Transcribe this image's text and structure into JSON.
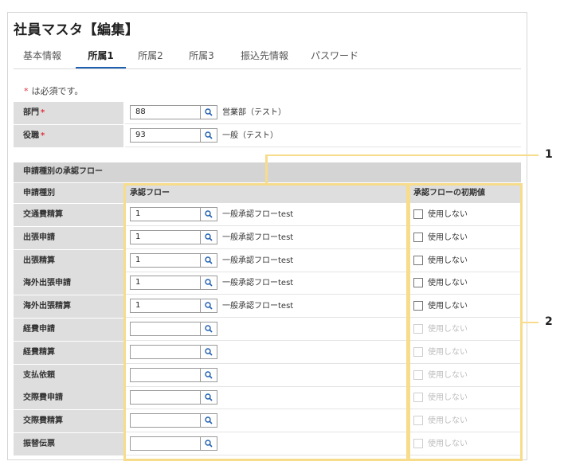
{
  "title": "社員マスタ【編集】",
  "tabs": [
    {
      "label": "基本情報",
      "active": false
    },
    {
      "label": "所属1",
      "active": true
    },
    {
      "label": "所属2",
      "active": false
    },
    {
      "label": "所属3",
      "active": false
    },
    {
      "label": "振込先情報",
      "active": false
    },
    {
      "label": "パスワード",
      "active": false
    }
  ],
  "required_note": {
    "star": "*",
    "text": "は必須です。"
  },
  "fields": [
    {
      "label": "部門",
      "required_star": "*",
      "value": "88",
      "display": "営業部（テスト）"
    },
    {
      "label": "役職",
      "required_star": "*",
      "value": "93",
      "display": "一般（テスト）"
    }
  ],
  "approval_section": {
    "title": "申請種別の承認フロー",
    "headers": {
      "type": "申請種別",
      "flow": "承認フロー",
      "initial": "承認フローの初期値"
    },
    "rows": [
      {
        "type": "交通費精算",
        "flow_value": "1",
        "flow_name": "一般承認フローtest",
        "checkbox_label": "使用しない",
        "enabled": true
      },
      {
        "type": "出張申請",
        "flow_value": "1",
        "flow_name": "一般承認フローtest",
        "checkbox_label": "使用しない",
        "enabled": true
      },
      {
        "type": "出張精算",
        "flow_value": "1",
        "flow_name": "一般承認フローtest",
        "checkbox_label": "使用しない",
        "enabled": true
      },
      {
        "type": "海外出張申請",
        "flow_value": "1",
        "flow_name": "一般承認フローtest",
        "checkbox_label": "使用しない",
        "enabled": true
      },
      {
        "type": "海外出張精算",
        "flow_value": "1",
        "flow_name": "一般承認フローtest",
        "checkbox_label": "使用しない",
        "enabled": true
      },
      {
        "type": "経費申請",
        "flow_value": "",
        "flow_name": "",
        "checkbox_label": "使用しない",
        "enabled": false
      },
      {
        "type": "経費精算",
        "flow_value": "",
        "flow_name": "",
        "checkbox_label": "使用しない",
        "enabled": false
      },
      {
        "type": "支払依頼",
        "flow_value": "",
        "flow_name": "",
        "checkbox_label": "使用しない",
        "enabled": false
      },
      {
        "type": "交際費申請",
        "flow_value": "",
        "flow_name": "",
        "checkbox_label": "使用しない",
        "enabled": false
      },
      {
        "type": "交際費精算",
        "flow_value": "",
        "flow_name": "",
        "checkbox_label": "使用しない",
        "enabled": false
      },
      {
        "type": "振替伝票",
        "flow_value": "",
        "flow_name": "",
        "checkbox_label": "使用しない",
        "enabled": false
      }
    ]
  },
  "callouts": [
    "1",
    "2"
  ],
  "colors": {
    "accent": "#1f5fb0",
    "required": "#e0343b",
    "highlight": "#f6dc8b"
  }
}
